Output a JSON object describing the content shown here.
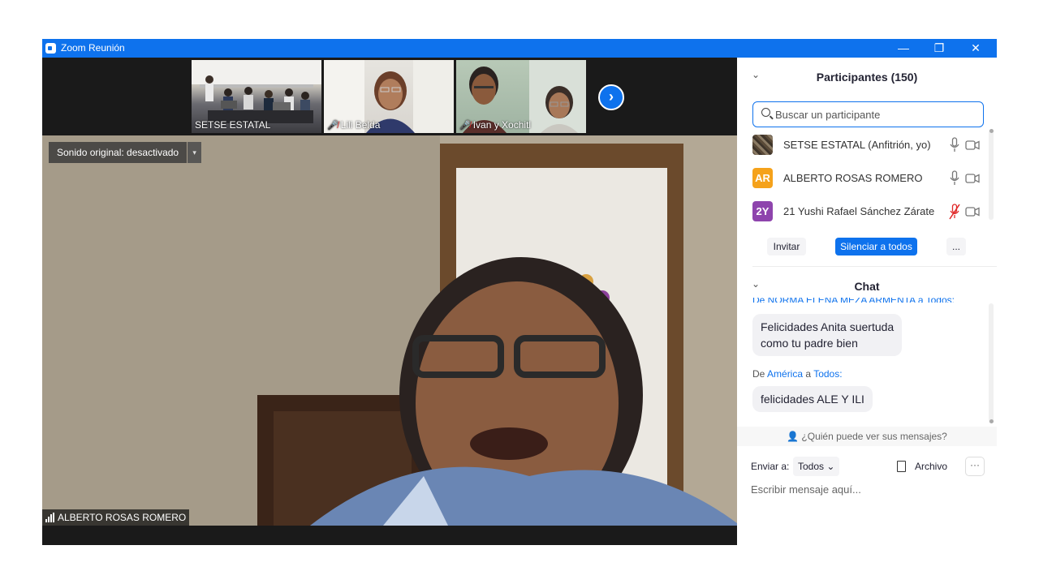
{
  "window": {
    "title": "Zoom Reunión",
    "controls": [
      "—",
      "❐",
      "✕"
    ]
  },
  "gallery": [
    {
      "name": "SETSE ESTATAL",
      "muted": false
    },
    {
      "name": "Lili Belda",
      "muted": true
    },
    {
      "name": "Ivan y Xochitl",
      "muted": true
    }
  ],
  "gallery_next": "›",
  "main": {
    "sound_label": "Sonido original: desactivado",
    "sound_caret": "▾",
    "speaker": "ALBERTO ROSAS ROMERO"
  },
  "participants": {
    "title": "Participantes (150)",
    "search_placeholder": "Buscar un participante",
    "list": [
      {
        "initials": "",
        "name": "SETSE ESTATAL (Anfitrión, yo)",
        "color": "#6b5a44",
        "mic_muted": false
      },
      {
        "initials": "AR",
        "name": "ALBERTO ROSAS ROMERO",
        "color": "#f5a21b",
        "mic_muted": false
      },
      {
        "initials": "2Y",
        "name": "21 Yushi Rafael Sánchez Zárate",
        "color": "#8e44ad",
        "mic_muted": true
      }
    ],
    "invite": "Invitar",
    "mute_all": "Silenciar a todos",
    "more": "..."
  },
  "chat": {
    "title": "Chat",
    "cut_off_line": "De NORMA ELENA MEZA ARMENTA a Todos:",
    "messages": [
      {
        "text_1": "Felicidades Anita suertuda",
        "text_2": "como tu padre bien"
      },
      {
        "from_prefix": "De",
        "from": "América",
        "to_prefix": "a",
        "to": "Todos:",
        "text": "felicidades ALE Y ILI"
      }
    ],
    "who_can_see": "¿Quién puede ver sus mensajes?",
    "send_to_label": "Enviar a:",
    "send_to_value": "Todos",
    "file_label": "Archivo",
    "more": "···",
    "input_placeholder": "Escribir mensaje aquí..."
  }
}
